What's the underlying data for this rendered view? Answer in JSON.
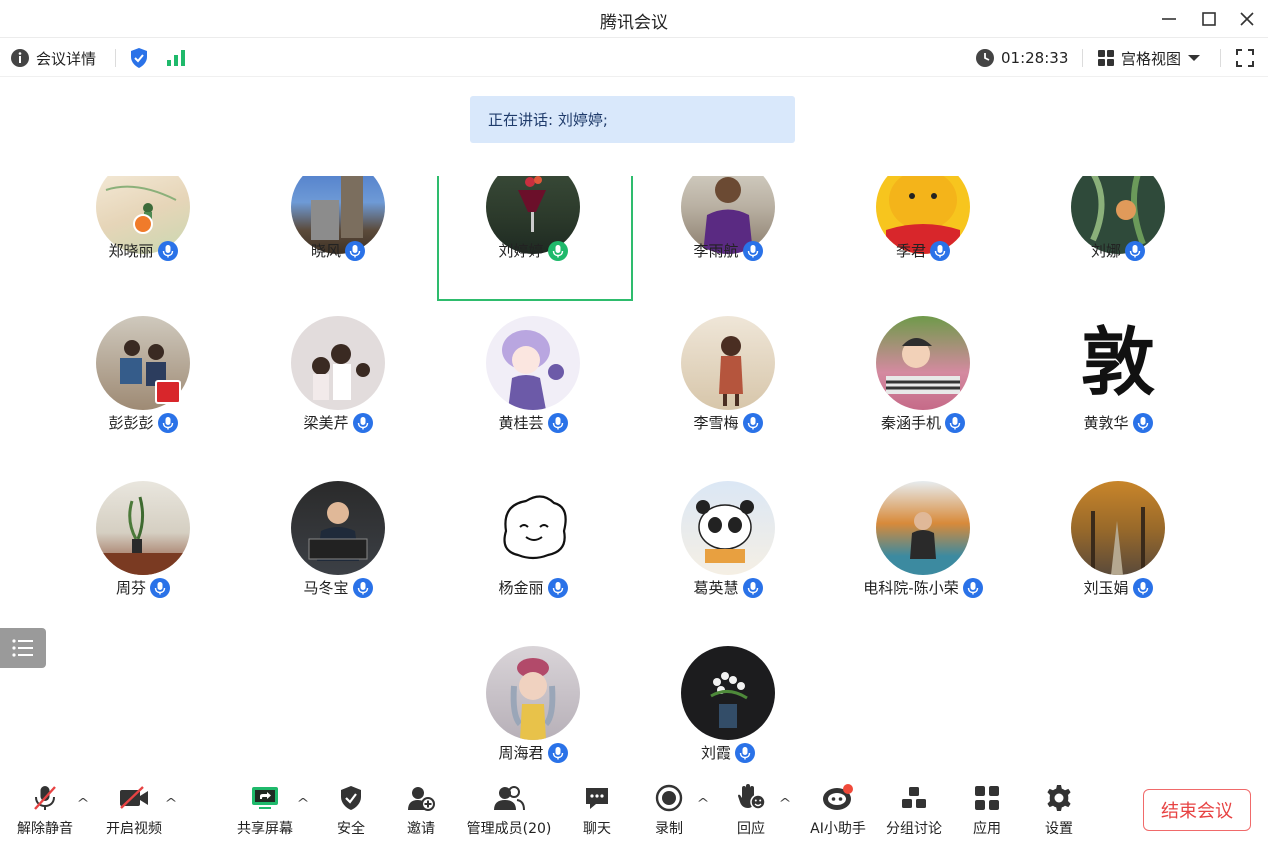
{
  "window": {
    "title": "腾讯会议",
    "controls": [
      "minimize-icon",
      "maximize-icon",
      "close-icon"
    ]
  },
  "infobar": {
    "details_label": "会议详情",
    "timer": "01:28:33",
    "view_label": "宫格视图"
  },
  "speaking": {
    "text": "正在讲话: 刘婷婷;"
  },
  "participants": [
    {
      "name": "郑晓丽",
      "mic": "on"
    },
    {
      "name": "晓风",
      "mic": "on"
    },
    {
      "name": "刘婷婷",
      "mic": "speaking"
    },
    {
      "name": "李雨航",
      "mic": "on"
    },
    {
      "name": "季君",
      "mic": "on"
    },
    {
      "name": "刘娜",
      "mic": "on"
    },
    {
      "name": "彭彭彭",
      "mic": "on"
    },
    {
      "name": "梁美芹",
      "mic": "on"
    },
    {
      "name": "黄桂芸",
      "mic": "on"
    },
    {
      "name": "李雪梅",
      "mic": "on"
    },
    {
      "name": "秦涵手机",
      "mic": "on"
    },
    {
      "name": "黄敦华",
      "mic": "on"
    },
    {
      "name": "周芬",
      "mic": "on"
    },
    {
      "name": "马冬宝",
      "mic": "on"
    },
    {
      "name": "杨金丽",
      "mic": "on"
    },
    {
      "name": "葛英慧",
      "mic": "on"
    },
    {
      "name": "电科院-陈小荣",
      "mic": "on"
    },
    {
      "name": "刘玉娟",
      "mic": "on"
    },
    {
      "name": "周海君",
      "mic": "on"
    },
    {
      "name": "刘霞",
      "mic": "on"
    }
  ],
  "avatar_glyph": "敦",
  "toolbar": {
    "unmute": "解除静音",
    "video": "开启视频",
    "share": "共享屏幕",
    "security": "安全",
    "invite": "邀请",
    "members": "管理成员(20)",
    "chat": "聊天",
    "record": "录制",
    "react": "回应",
    "ai": "AI小助手",
    "breakout": "分组讨论",
    "apps": "应用",
    "settings": "设置",
    "end": "结束会议"
  },
  "colors": {
    "accent_blue": "#2a72e8",
    "speaking_green": "#2ebc6d",
    "end_red": "#e74343",
    "banner_bg": "#d9e8fb"
  }
}
